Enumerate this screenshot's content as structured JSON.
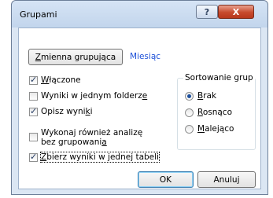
{
  "window": {
    "title": "Grupami",
    "help_label": "?",
    "close_label": "X"
  },
  "grouping": {
    "button_label": "Zmienna grupująca",
    "value": "Miesiąc"
  },
  "checkboxes": [
    {
      "label": "Włączone",
      "checked": true
    },
    {
      "label": "Wyniki w jednym folderze",
      "checked": false
    },
    {
      "label": "Opisz wyniki",
      "checked": true
    },
    {
      "label_line1": "Wykonaj również analizę",
      "label_line2": "bez grupowania",
      "checked": false
    },
    {
      "label": "Zbierz wyniki w jednej tabeli",
      "checked": true
    }
  ],
  "sort": {
    "title": "Sortowanie grup",
    "options": [
      {
        "label": "Brak",
        "selected": true
      },
      {
        "label": "Rosnąco",
        "selected": false
      },
      {
        "label": "Malejąco",
        "selected": false
      }
    ]
  },
  "footer": {
    "ok_label": "OK",
    "cancel_label": "Anuluj"
  }
}
